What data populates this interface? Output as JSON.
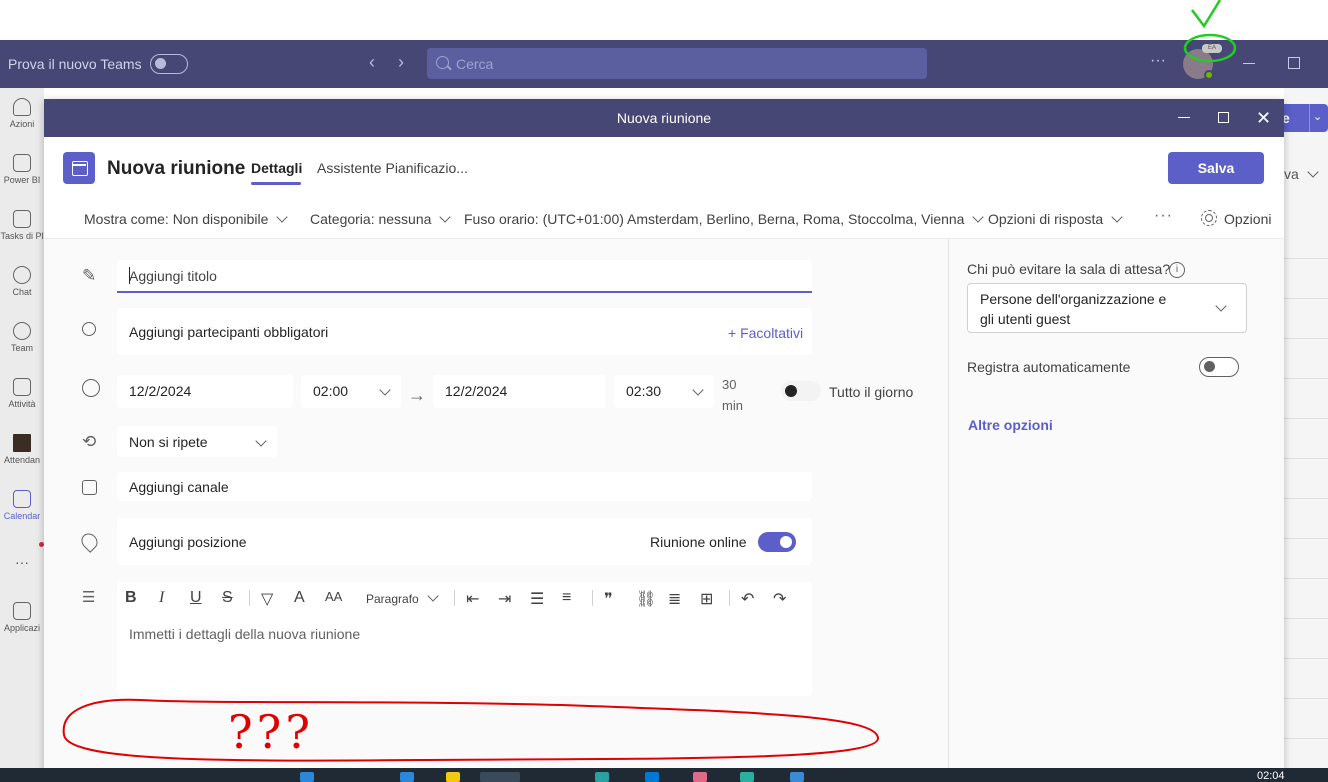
{
  "teams_bar": {
    "try_new_teams": "Prova il nuovo Teams",
    "search_placeholder": "Cerca",
    "more": "···",
    "avatar_initials": "EA"
  },
  "rail": [
    {
      "label": "Azioni",
      "icon": "bell-icon"
    },
    {
      "label": "Power BI",
      "icon": "chart-icon"
    },
    {
      "label": "Tasks di Pl",
      "icon": "tasks-icon"
    },
    {
      "label": "Chat",
      "icon": "chat-icon"
    },
    {
      "label": "Team",
      "icon": "team-icon"
    },
    {
      "label": "Attività",
      "icon": "assignment-icon"
    },
    {
      "label": "Attendan",
      "icon": "attendance-icon"
    },
    {
      "label": "Calendar",
      "icon": "calendar-icon",
      "active": true
    },
    {
      "label": "···",
      "icon": "more-icon"
    },
    {
      "label": "Applicazi",
      "icon": "apps-icon"
    }
  ],
  "background": {
    "button_label": "e",
    "va_text": "va"
  },
  "dialog": {
    "window_title": "Nuova riunione",
    "heading": "Nuova riunione",
    "tabs": [
      "Dettagli",
      "Assistente Pianificazio..."
    ],
    "save": "Salva",
    "toolbar": {
      "show_as": "Mostra come: Non disponibile",
      "category": "Categoria: nessuna",
      "timezone": "Fuso orario: (UTC+01:00) Amsterdam, Berlino, Berna, Roma, Stoccolma, Vienna",
      "response": "Opzioni di risposta",
      "more": "···",
      "options": "Opzioni"
    },
    "form": {
      "title_placeholder": "Aggiungi titolo",
      "attendees": "Aggiungi partecipanti obbligatori",
      "optional": "+ Facoltativi",
      "start_date": "12/2/2024",
      "start_time": "02:00",
      "end_date": "12/2/2024",
      "end_time": "02:30",
      "duration_value": "30",
      "duration_unit": "min",
      "all_day": "Tutto il giorno",
      "repeat": "Non si ripete",
      "channel": "Aggiungi canale",
      "location": "Aggiungi posizione",
      "online_meeting": "Riunione online",
      "paragraph": "Paragrafo",
      "details_placeholder": "Immetti i dettagli della nuova riunione"
    },
    "right_panel": {
      "lobby_label": "Chi può evitare la sala di attesa?",
      "lobby_value": "Persone dell'organizzazione e gli utenti guest",
      "record_auto": "Registra automaticamente",
      "more_options": "Altre opzioni"
    }
  },
  "annotation": {
    "text": "???"
  },
  "taskbar": {
    "time": "02:04"
  },
  "colors": {
    "teams_purple": "#464775",
    "accent": "#5b5fc7",
    "annotation_red": "#e00000",
    "annotation_green": "#22cc22"
  }
}
